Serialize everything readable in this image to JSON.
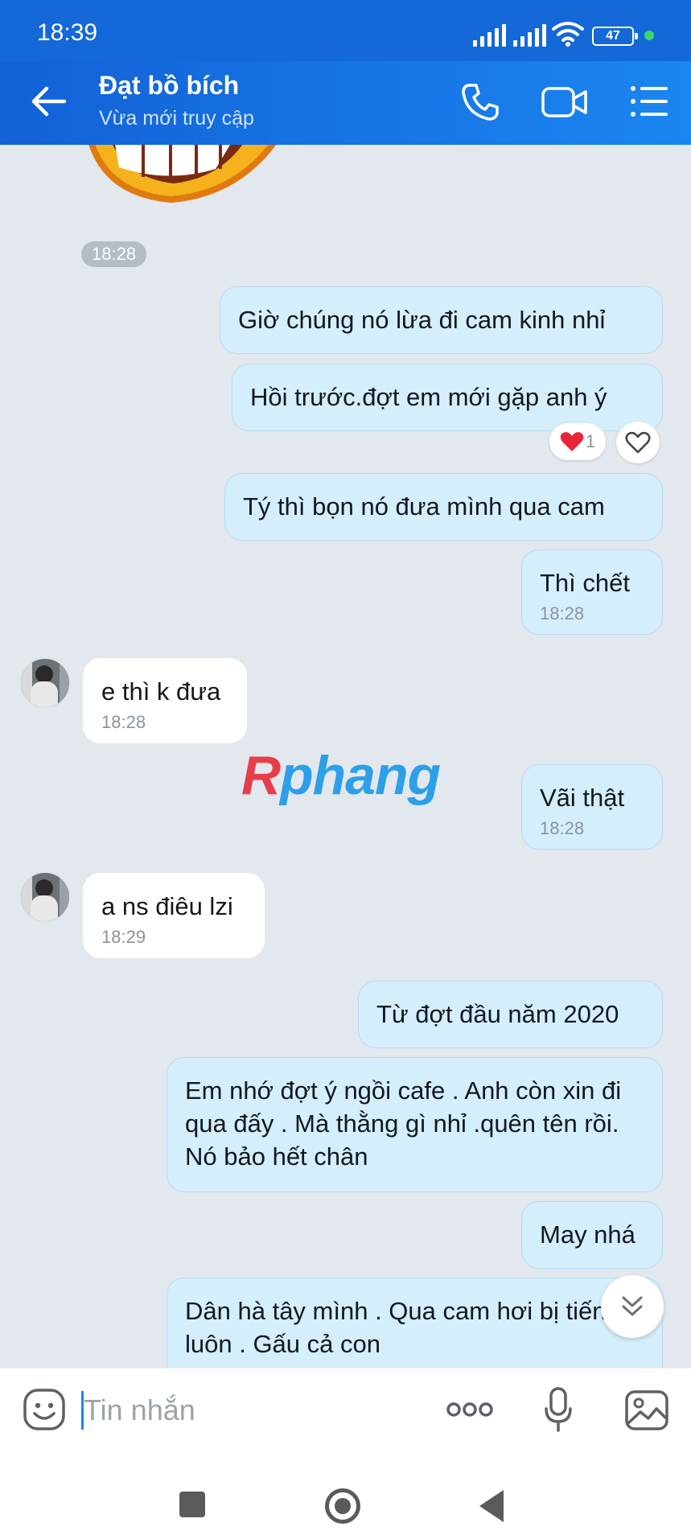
{
  "status_bar": {
    "time": "18:39",
    "battery": "47"
  },
  "header": {
    "contact_name": "Đạt bồ bích",
    "contact_status": "Vừa mới truy cập"
  },
  "chat": {
    "sticker_time": "18:28",
    "messages": [
      {
        "from": "me",
        "text": "Giờ chúng nó lừa đi cam kinh nhỉ"
      },
      {
        "from": "me",
        "text": "Hồi trước.đợt em mới gặp anh ý",
        "reaction": "1"
      },
      {
        "from": "me",
        "text": "Tý thì bọn nó đưa mình qua cam"
      },
      {
        "from": "me",
        "text": "Thì chết",
        "time": "18:28"
      },
      {
        "from": "other",
        "text": "e thì k đưa",
        "time": "18:28"
      },
      {
        "from": "me",
        "text": "Vãi thật",
        "time": "18:28"
      },
      {
        "from": "other",
        "text": "a ns điêu lzi",
        "time": "18:29"
      },
      {
        "from": "me",
        "text": "Từ đợt đầu năm 2020"
      },
      {
        "from": "me",
        "text": "Em nhớ đợt ý ngồi cafe . Anh còn xin đi qua đấy . Mà thằng gì nhỉ .quên tên rồi. Nó bảo hết chân"
      },
      {
        "from": "me",
        "text": "May nhá"
      },
      {
        "from": "me",
        "text": "Dân hà tây mình . Qua cam hơi bị tiếng luôn . Gấu cả con"
      }
    ],
    "watermark": {
      "part1": "R",
      "part2": "phang"
    }
  },
  "input": {
    "placeholder": "Tin nhắn"
  },
  "colors": {
    "header": "#1a86f0",
    "my_bubble": "#d5eefc",
    "other_bubble": "#ffffff",
    "background": "#e2e8ee"
  }
}
